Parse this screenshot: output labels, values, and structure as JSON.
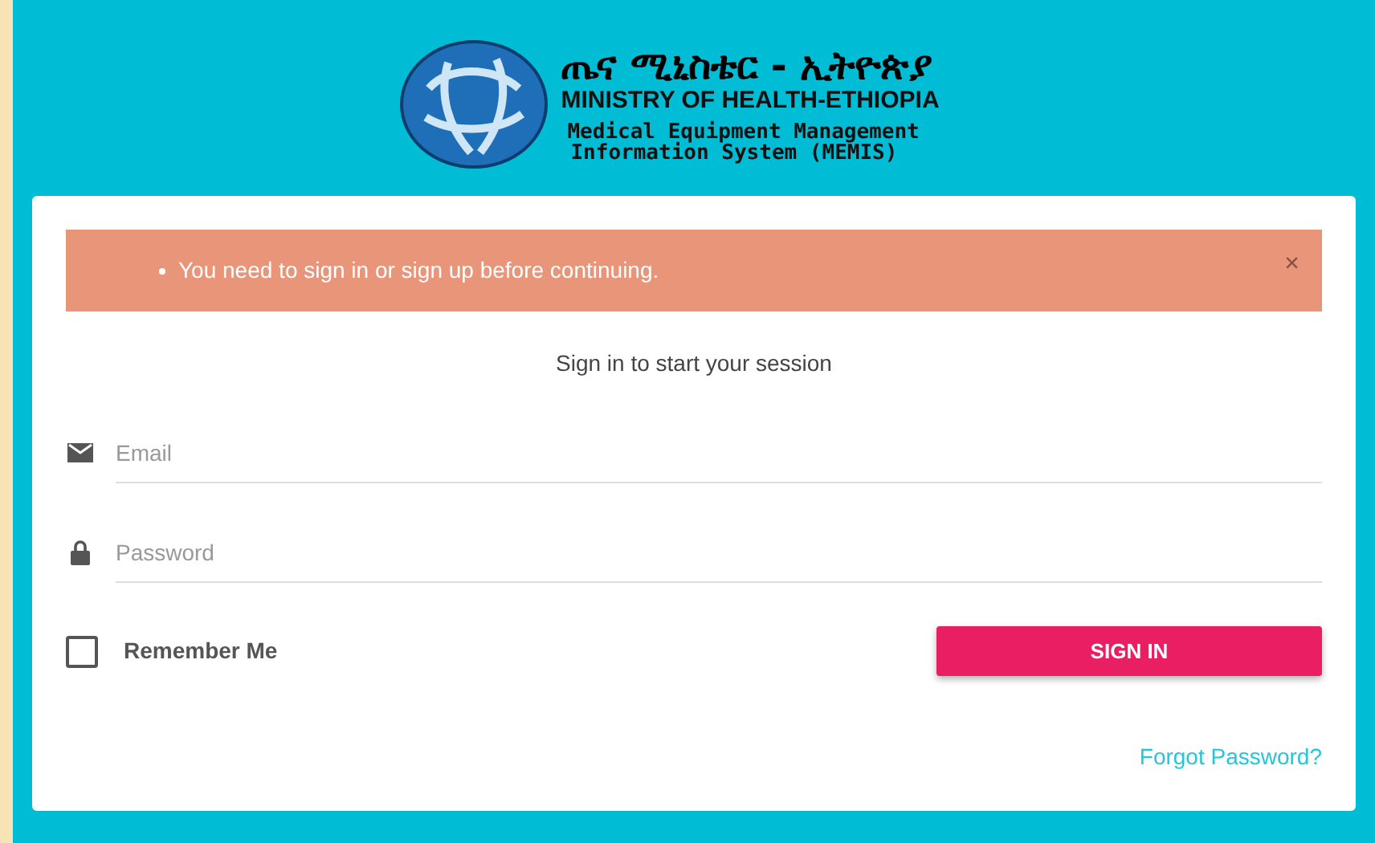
{
  "header": {
    "title_amharic": "ጤና ሚኒስቴር - ኢትዮጵያ",
    "title": "MINISTRY OF HEALTH-ETHIOPIA",
    "subtitle_line_1": "Medical Equipment Management",
    "subtitle_line_2": "Information System (MEMIS)"
  },
  "alert": {
    "message": "You need to sign in or sign up before continuing.",
    "close": "×"
  },
  "intro": "Sign in to start your session",
  "fields": [
    {
      "kind": "email",
      "placeholder": "Email"
    },
    {
      "kind": "password",
      "placeholder": "Password"
    }
  ],
  "remember": {
    "label": "Remember Me",
    "checked": false
  },
  "sign_in": "SIGN IN",
  "forgot": "Forgot Password?"
}
